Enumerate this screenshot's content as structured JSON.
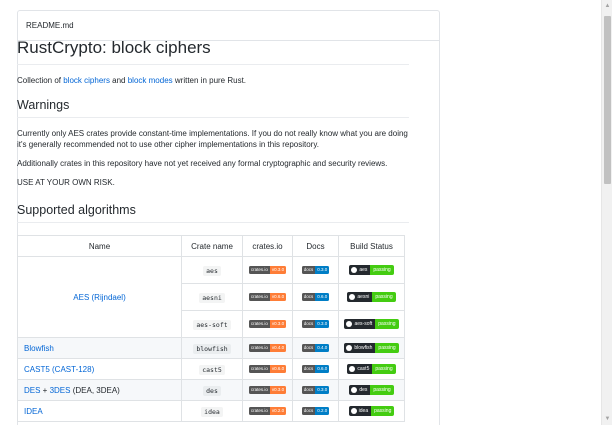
{
  "readme": {
    "filename": "README.md",
    "title": "RustCrypto: block ciphers",
    "intro": {
      "before": "Collection of ",
      "link1": "block ciphers",
      "middle": " and ",
      "link2": "block modes",
      "after": " written in pure Rust."
    },
    "warnings_heading": "Warnings",
    "warning_p1": "Currently only AES crates provide constant-time implementations. If you do not really know what you are doing it's generally recommended not to use other cipher implementations in this repository.",
    "warning_p2": "Additionally crates in this repository have not yet received any formal cryptographic and security reviews.",
    "warning_p3": "USE AT YOUR OWN RISK.",
    "algorithms_heading": "Supported algorithms"
  },
  "table": {
    "headers": [
      "Name",
      "Crate name",
      "crates.io",
      "Docs",
      "Build Status"
    ],
    "badge_labels": {
      "crates": "crates.io",
      "docs": "docs",
      "passing": "passing"
    },
    "rows": [
      {
        "name": "AES (Rijndael)",
        "crate": "aes",
        "crates_ver": "v0.3.0",
        "docs_ver": "0.3.0",
        "build": "aes"
      },
      {
        "name": "",
        "crate": "aesni",
        "crates_ver": "v0.6.0",
        "docs_ver": "0.6.0",
        "build": "aesni"
      },
      {
        "name": "",
        "crate": "aes-soft",
        "crates_ver": "v0.3.0",
        "docs_ver": "0.3.0",
        "build": "aes-soft"
      },
      {
        "name": "Blowfish",
        "crate": "blowfish",
        "crates_ver": "v0.4.0",
        "docs_ver": "0.4.0",
        "build": "blowfish"
      },
      {
        "name": "CAST5 (CAST-128)",
        "crate": "cast5",
        "crates_ver": "v0.6.0",
        "docs_ver": "0.6.0",
        "build": "cast5"
      },
      {
        "name_a": "DES",
        "name_mid": " + ",
        "name_b": "3DES",
        "name_rest": " (DEA, 3DEA)",
        "crate": "des",
        "crates_ver": "v0.3.0",
        "docs_ver": "0.3.0",
        "build": "des"
      },
      {
        "name": "IDEA",
        "crate": "idea",
        "crates_ver": "v0.2.0",
        "docs_ver": "0.2.0",
        "build": "idea"
      }
    ]
  },
  "colors": {
    "link": "#0366d6",
    "crates_badge": "#fe7d37",
    "docs_badge": "#007ec6",
    "passing_badge": "#44cc11"
  }
}
